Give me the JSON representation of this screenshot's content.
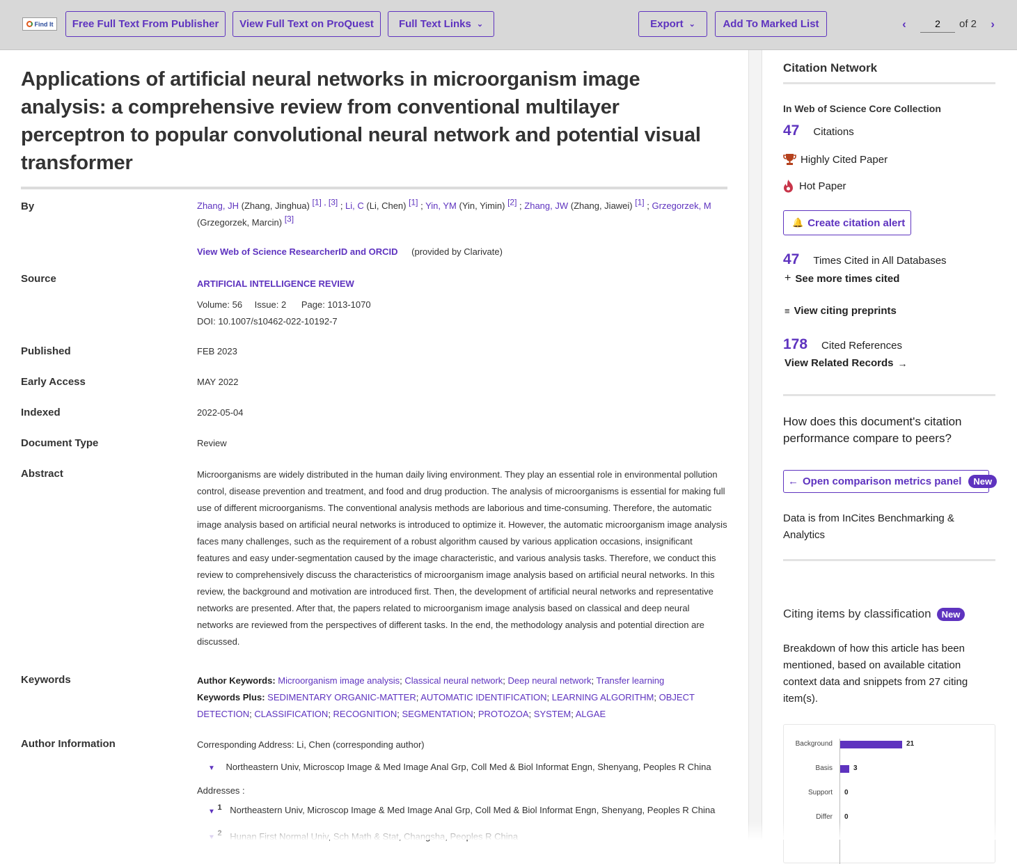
{
  "toolbar": {
    "findit_label": "Find It",
    "free_full_text": "Free Full Text From Publisher",
    "proquest": "View Full Text on ProQuest",
    "full_text_links": "Full Text Links",
    "export": "Export",
    "add_marked": "Add To Marked List",
    "page_current": "2",
    "page_of": "of 2"
  },
  "record": {
    "title": "Applications of artificial neural networks in microorganism image analysis: a comprehensive review from conventional multilayer perceptron to popular convolutional neural network and potential visual transformer",
    "labels": {
      "by": "By",
      "source": "Source",
      "published": "Published",
      "early_access": "Early Access",
      "indexed": "Indexed",
      "doc_type": "Document Type",
      "abstract": "Abstract",
      "keywords": "Keywords",
      "author_info": "Author Information"
    },
    "authors": [
      {
        "short": "Zhang, JH",
        "full": "(Zhang, Jinghua)",
        "refs": "[1] , [3]"
      },
      {
        "short": "Li, C",
        "full": "(Li, Chen)",
        "refs": "[1]"
      },
      {
        "short": "Yin, YM",
        "full": "(Yin, Yimin)",
        "refs": "[2]"
      },
      {
        "short": "Zhang, JW",
        "full": "(Zhang, Jiawei)",
        "refs": "[1]"
      },
      {
        "short": "Grzegorzek, M",
        "full": "(Grzegorzek, Marcin)",
        "refs": "[3]"
      }
    ],
    "researcher_link": "View Web of Science ResearcherID and ORCID",
    "provided_by": "(provided by Clarivate)",
    "source_name": "ARTIFICIAL INTELLIGENCE REVIEW",
    "volume": "Volume: 56",
    "issue": "Issue: 2",
    "page": "Page: 1013-1070",
    "doi": "DOI: 10.1007/s10462-022-10192-7",
    "published": "FEB 2023",
    "early_access": "MAY 2022",
    "indexed": "2022-05-04",
    "doc_type": "Review",
    "abstract": "Microorganisms are widely distributed in the human daily living environment. They play an essential role in environmental pollution control, disease prevention and treatment, and food and drug production. The analysis of microorganisms is essential for making full use of different microorganisms. The conventional analysis methods are laborious and time-consuming. Therefore, the automatic image analysis based on artificial neural networks is introduced to optimize it. However, the automatic microorganism image analysis faces many challenges, such as the requirement of a robust algorithm caused by various application occasions, insignificant features and easy under-segmentation caused by the image characteristic, and various analysis tasks. Therefore, we conduct this review to comprehensively discuss the characteristics of microorganism image analysis based on artificial neural networks. In this review, the background and motivation are introduced first. Then, the development of artificial neural networks and representative networks are presented. After that, the papers related to microorganism image analysis based on classical and deep neural networks are reviewed from the perspectives of different tasks. In the end, the methodology analysis and potential direction are discussed.",
    "author_keywords_label": "Author Keywords:",
    "author_keywords": [
      "Microorganism image analysis",
      "Classical neural network",
      "Deep neural network",
      "Transfer learning"
    ],
    "keywords_plus_label": "Keywords Plus:",
    "keywords_plus": [
      "SEDIMENTARY ORGANIC-MATTER",
      "AUTOMATIC IDENTIFICATION",
      "LEARNING ALGORITHM",
      "OBJECT DETECTION",
      "CLASSIFICATION",
      "RECOGNITION",
      "SEGMENTATION",
      "PROTOZOA",
      "SYSTEM",
      "ALGAE"
    ],
    "corresponding": "Corresponding Address: Li, Chen  (corresponding author)",
    "corr_address": "Northeastern Univ, Microscop Image & Med Image Anal Grp, Coll Med & Biol Informat Engn, Shenyang, Peoples R China",
    "addresses_label": "Addresses :",
    "addresses": [
      {
        "num": "1",
        "text": "Northeastern Univ, Microscop Image & Med Image Anal Grp, Coll Med & Biol Informat Engn, Shenyang, Peoples R China"
      },
      {
        "num": "2",
        "text": "Hunan First Normal Univ, Sch Math & Stat, Changsha, Peoples R China"
      }
    ]
  },
  "sidebar": {
    "heading": "Citation Network",
    "collection": "In Web of Science Core Collection",
    "citations_count": "47",
    "citations_label": "Citations",
    "highly_cited": "Highly Cited Paper",
    "hot_paper": "Hot Paper",
    "create_alert": "Create citation alert",
    "times_cited_count": "47",
    "times_cited_label": "Times Cited in All Databases",
    "see_more": "See more times cited",
    "view_preprints": "View citing preprints",
    "cited_refs_count": "178",
    "cited_refs_label": "Cited References",
    "view_related": "View Related Records",
    "compare_question": "How does this document's citation performance compare to peers?",
    "open_comparison": "Open comparison metrics panel",
    "new_badge": "New",
    "data_source": "Data is from InCites Benchmarking & Analytics",
    "citing_heading": "Citing items by classification",
    "citing_desc": "Breakdown of how this article has been mentioned, based on available citation context data and snippets from 27 citing item(s)."
  },
  "chart_data": {
    "type": "bar",
    "orientation": "horizontal",
    "categories": [
      "Background",
      "Basis",
      "Support",
      "Differ"
    ],
    "values": [
      21,
      3,
      0,
      0
    ]
  },
  "colors": {
    "accent": "#5e33bf",
    "toolbar": "#d8d8d8",
    "trophy": "#b5411d",
    "flame": "#c8354a"
  }
}
